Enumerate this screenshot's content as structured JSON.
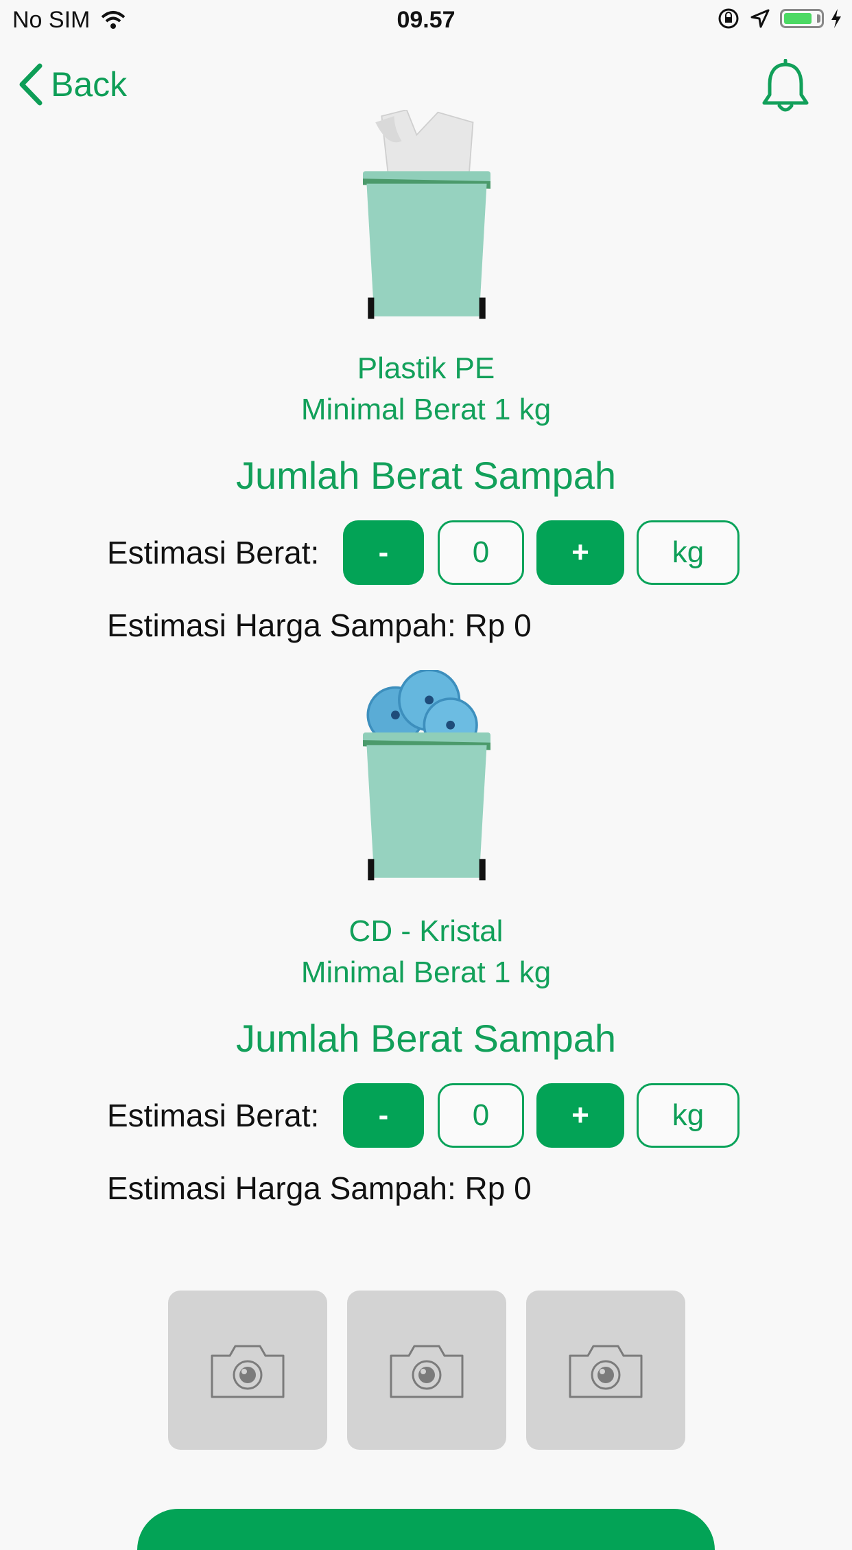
{
  "status": {
    "carrier": "No SIM",
    "time": "09.57",
    "battery_level": 0.8
  },
  "nav": {
    "back_label": "Back",
    "bell_icon": "bell-icon",
    "accent": "#12a05a"
  },
  "items": [
    {
      "name": "Plastik PE",
      "min_weight": "Minimal Berat 1 kg",
      "section_title": "Jumlah Berat Sampah",
      "estimate_label": "Estimasi Berat:",
      "minus_label": "-",
      "weight_value": "0",
      "plus_label": "+",
      "unit": "kg",
      "price_text": "Estimasi Harga Sampah: Rp 0",
      "icon": "plastic-bin-icon"
    },
    {
      "name": "CD - Kristal",
      "min_weight": "Minimal Berat 1 kg",
      "section_title": "Jumlah Berat Sampah",
      "estimate_label": "Estimasi Berat:",
      "minus_label": "-",
      "weight_value": "0",
      "plus_label": "+",
      "unit": "kg",
      "price_text": "Estimasi Harga Sampah: Rp 0",
      "icon": "cd-bin-icon"
    }
  ],
  "photos": {
    "icon": "camera-icon",
    "count": 3
  },
  "colors": {
    "primary": "#03a356",
    "text_green": "#12a05a",
    "bin": "#95d1bf",
    "slot": "#d3d3d3"
  }
}
